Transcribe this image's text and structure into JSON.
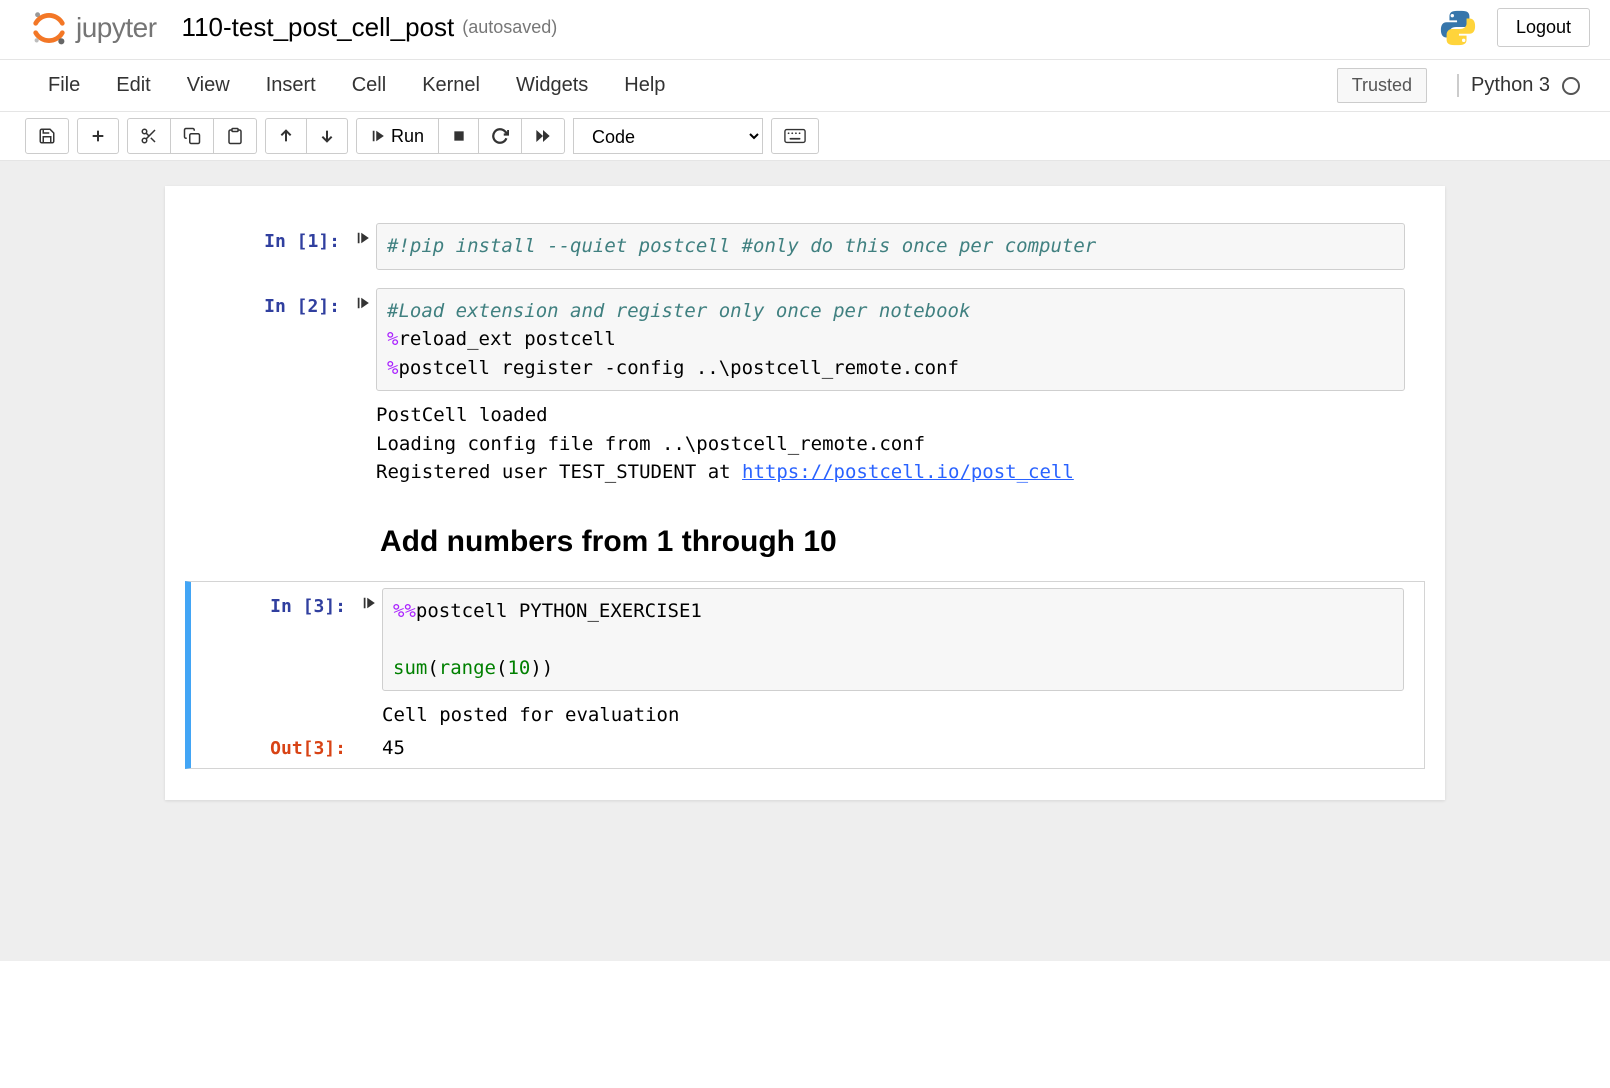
{
  "header": {
    "logo_text": "jupyter",
    "notebook_name": "110-test_post_cell_post",
    "save_status": "(autosaved)",
    "logout": "Logout"
  },
  "menubar": {
    "items": [
      "File",
      "Edit",
      "View",
      "Insert",
      "Cell",
      "Kernel",
      "Widgets",
      "Help"
    ],
    "trusted": "Trusted",
    "kernel_name": "Python 3"
  },
  "toolbar": {
    "run_label": "Run",
    "cell_type": "Code"
  },
  "cells": [
    {
      "prompt": "In [1]:",
      "code": {
        "comment1": "#!pip install --quiet postcell #only do this once per computer"
      }
    },
    {
      "prompt": "In [2]:",
      "code": {
        "comment": "#Load extension and register only once per notebook",
        "magic1a": "%",
        "magic1b": "reload_ext postcell",
        "magic2a": "%",
        "magic2b": "postcell register -config ..\\postcell_remote.conf"
      },
      "output": {
        "text1": "PostCell loaded\nLoading config file from ..\\postcell_remote.conf\nRegistered user TEST_STUDENT at ",
        "link": "https://postcell.io/post_cell"
      }
    }
  ],
  "markdown": {
    "heading": "Add numbers from 1 through 10"
  },
  "cell3": {
    "prompt": "In [3]:",
    "code": {
      "magic": "%%",
      "rest": "postcell PYTHON_EXERCISE1",
      "blank": "",
      "fn1": "sum",
      "p1": "(",
      "fn2": "range",
      "p2": "(",
      "num": "10",
      "p3": "))"
    },
    "output_text": "Cell posted for evaluation",
    "out_prompt": "Out[3]:",
    "out_value": "45"
  }
}
